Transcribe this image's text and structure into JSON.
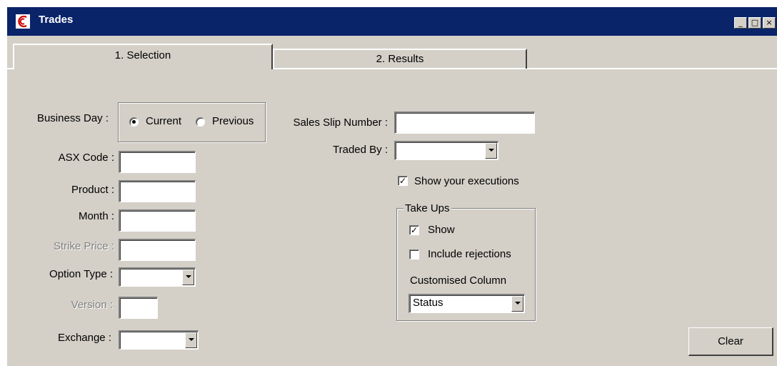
{
  "window": {
    "title": "Trades"
  },
  "tabs": [
    {
      "label": "1. Selection"
    },
    {
      "label": "2. Results"
    }
  ],
  "form": {
    "business_day": {
      "label": "Business Day :",
      "options": [
        "Current",
        "Previous"
      ],
      "selected": "Current"
    },
    "asx_code": {
      "label": "ASX Code :",
      "value": ""
    },
    "product": {
      "label": "Product :",
      "value": ""
    },
    "month": {
      "label": "Month :",
      "value": ""
    },
    "strike_price": {
      "label": "Strike Price :",
      "value": ""
    },
    "option_type": {
      "label": "Option Type :",
      "value": ""
    },
    "version": {
      "label": "Version :",
      "value": ""
    },
    "exchange": {
      "label": "Exchange :",
      "value": ""
    },
    "sales_slip_number": {
      "label": "Sales Slip Number :",
      "value": ""
    },
    "traded_by": {
      "label": "Traded By :",
      "value": ""
    },
    "show_executions": {
      "label": "Show your executions",
      "checked": true
    },
    "take_ups": {
      "title": "Take Ups",
      "show": {
        "label": "Show",
        "checked": true
      },
      "include_rejections": {
        "label": "Include rejections",
        "checked": false
      },
      "customised_column": {
        "label": "Customised Column",
        "value": "Status"
      }
    }
  },
  "buttons": {
    "clear": "Clear"
  },
  "icons": {
    "app": "asx-logo-icon",
    "minimize": "minimize-icon",
    "maximize": "maximize-icon",
    "close": "close-icon"
  },
  "colors": {
    "titlebar": "#0a246a",
    "face": "#d4d0c8",
    "logo": "#cc0000"
  }
}
